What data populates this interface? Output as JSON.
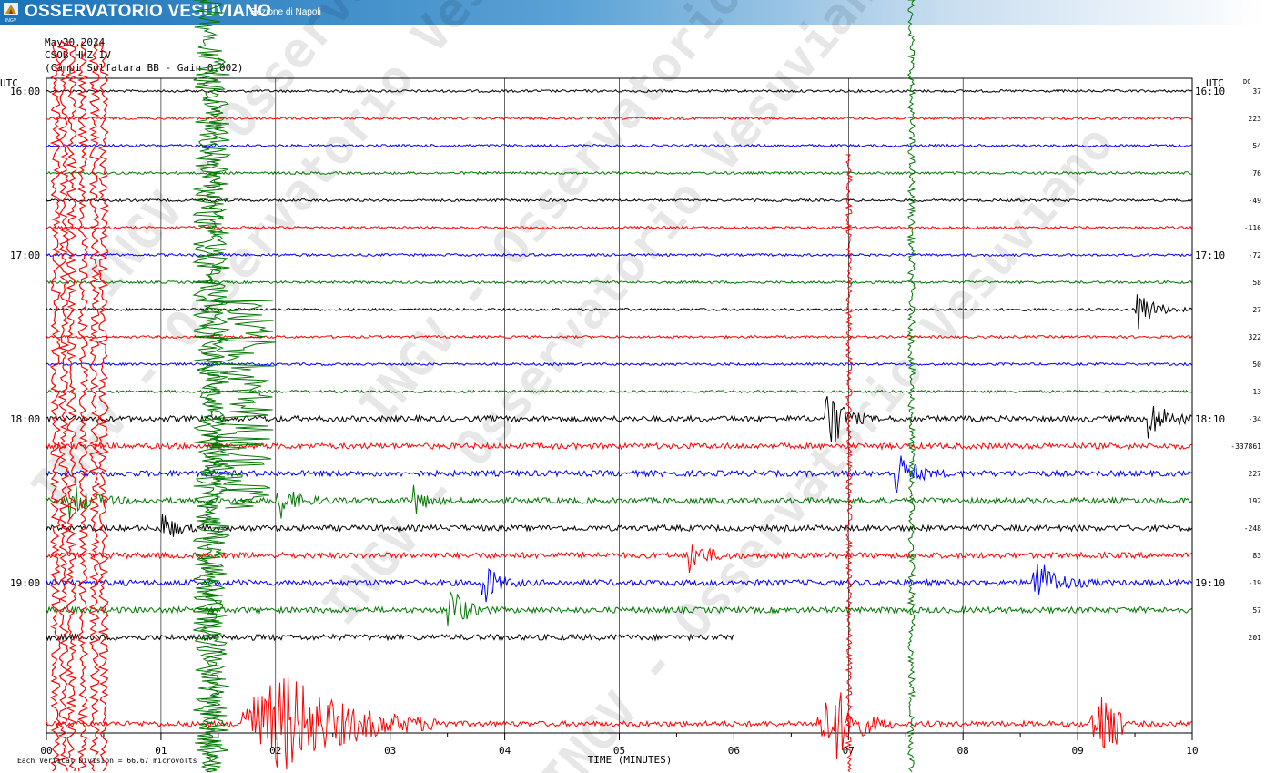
{
  "header": {
    "title": "OSSERVATORIO VESUVIANO",
    "subtitle": "Sezione di Napoli",
    "logo_text": "INGV"
  },
  "info": {
    "date": "May20,2024",
    "station": "CSOB HHZ IV",
    "description": "(Campi Solfatara BB - Gain 0.002)"
  },
  "chart_data": {
    "type": "line",
    "xlabel": "TIME (MINUTES)",
    "xlim": [
      0,
      10
    ],
    "x_ticks": [
      "00",
      "01",
      "02",
      "03",
      "04",
      "05",
      "06",
      "07",
      "08",
      "09",
      "10"
    ],
    "left_axis_label": "UTC",
    "right_axis_label": "UTC",
    "dc_label": "DC",
    "left_hour_labels": [
      {
        "row": 0,
        "text": "16:00"
      },
      {
        "row": 6,
        "text": "17:00"
      },
      {
        "row": 12,
        "text": "18:00"
      },
      {
        "row": 18,
        "text": "19:00"
      }
    ],
    "right_hour_labels": [
      {
        "row": 0,
        "text": "16:10"
      },
      {
        "row": 6,
        "text": "17:10"
      },
      {
        "row": 12,
        "text": "18:10"
      },
      {
        "row": 18,
        "text": "19:10"
      }
    ],
    "dc_offsets": [
      "37",
      "223",
      "54",
      "76",
      "-49",
      "-116",
      "-72",
      "58",
      "27",
      "322",
      "50",
      "13",
      "-34",
      "-337861",
      "227",
      "192",
      "-248",
      "83",
      "-19",
      "57",
      "201"
    ],
    "trace_colors": [
      "#000000",
      "#ff0000",
      "#0000ff",
      "#007700"
    ],
    "grid": true,
    "scale_note": "Each Vertical Division = 66.67 microvolts",
    "watermark": "INGV - Osservatorio Vesuviano",
    "trace_count": 22,
    "last_complete_trace_minutes": 6.0,
    "events": [
      {
        "row": 13,
        "minute": 1.3,
        "amp": 220,
        "dur": 1.2,
        "color": "#007700"
      },
      {
        "row": 12,
        "minute": 6.8,
        "amp": 60,
        "dur": 0.4
      },
      {
        "row": 12,
        "minute": 9.6,
        "amp": 25,
        "dur": 0.6
      },
      {
        "row": 8,
        "minute": 9.5,
        "amp": 30,
        "dur": 0.5
      },
      {
        "row": 13,
        "minute": 7.5,
        "amp": 300,
        "dur": 0.6,
        "color": "#007700"
      },
      {
        "row": 14,
        "minute": 7.4,
        "amp": 30,
        "dur": 0.5
      },
      {
        "row": 15,
        "minute": 0.2,
        "amp": 20,
        "dur": 0.6
      },
      {
        "row": 15,
        "minute": 2.0,
        "amp": 25,
        "dur": 0.5
      },
      {
        "row": 15,
        "minute": 3.2,
        "amp": 20,
        "dur": 0.3
      },
      {
        "row": 16,
        "minute": 1.0,
        "amp": 20,
        "dur": 0.4
      },
      {
        "row": 17,
        "minute": 5.6,
        "amp": 20,
        "dur": 0.5
      },
      {
        "row": 18,
        "minute": 3.8,
        "amp": 30,
        "dur": 0.4
      },
      {
        "row": 18,
        "minute": 8.6,
        "amp": 35,
        "dur": 0.6
      },
      {
        "row": 19,
        "minute": 3.5,
        "amp": 40,
        "dur": 0.4
      },
      {
        "row": 21,
        "minute": 2.0,
        "amp": 70,
        "dur": 2.0
      },
      {
        "row": 21,
        "minute": 6.8,
        "amp": 60,
        "dur": 0.7
      }
    ]
  }
}
